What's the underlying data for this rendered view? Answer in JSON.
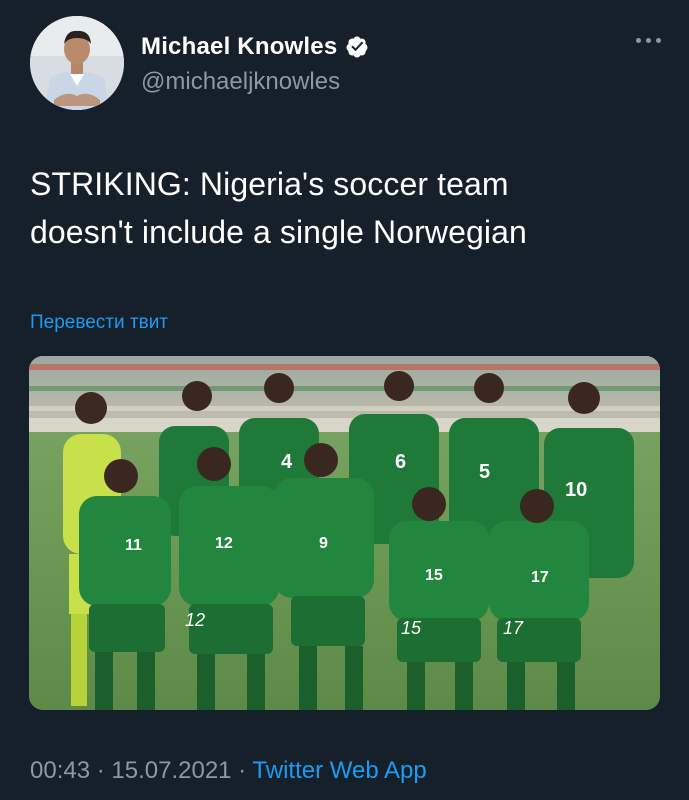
{
  "author": {
    "display_name": "Michael Knowles",
    "handle": "@michaeljknowles",
    "verified_icon": "verified-badge-icon"
  },
  "tweet": {
    "lines": [
      "STRIKING: Nigeria's soccer team",
      "doesn't include a single Norwegian"
    ],
    "translate_label": "Перевести твит"
  },
  "meta": {
    "time": "00:43",
    "separator1": " · ",
    "date": "15.07.2021",
    "separator2": " · ",
    "source": "Twitter Web App"
  },
  "photo": {
    "jersey_numbers": [
      "4",
      "6",
      "5",
      "10",
      "11",
      "12",
      "9",
      "15",
      "17",
      "12",
      "15",
      "17"
    ]
  },
  "colors": {
    "background": "#15202b",
    "link": "#1d9bf0",
    "secondary_text": "#8b98a5",
    "jersey_green": "#1f7a3a"
  }
}
